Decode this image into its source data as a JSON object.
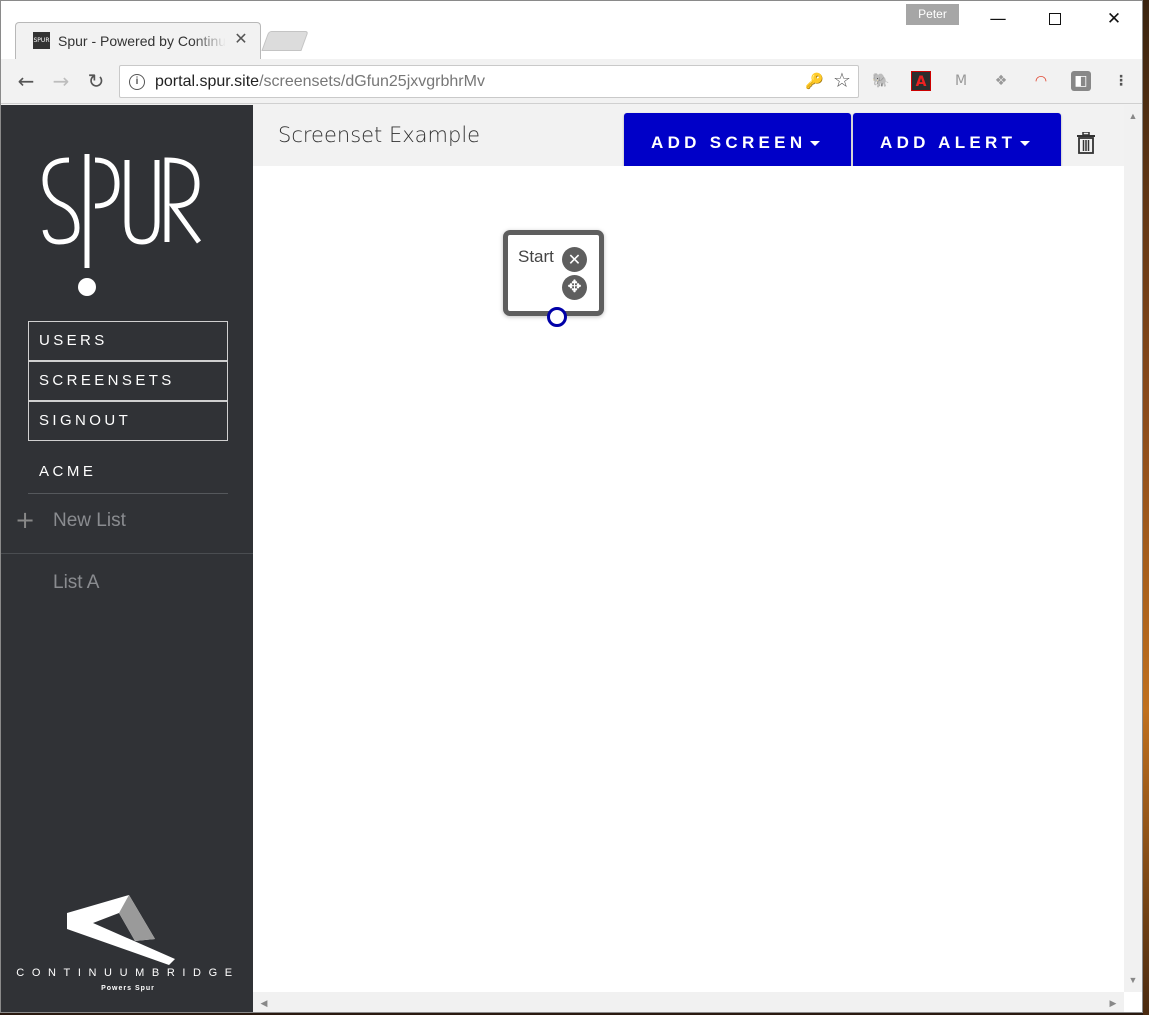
{
  "browser": {
    "tab_favicon_text": "SPUR",
    "tab_title": "Spur - Powered by Continuum",
    "tab_close": "✕",
    "profile_name": "Peter",
    "window_minimize": "—",
    "window_close": "✕",
    "back_icon": "←",
    "forward_icon": "→",
    "reload_icon": "↻",
    "info_icon": "i",
    "url_host": "portal.spur.site",
    "url_path": "/screensets/dGfun25jxvgrbhrMv",
    "key_icon": "🔑",
    "star_icon": "☆",
    "extensions": {
      "evernote": "🐘",
      "pdf": "A",
      "gmail": "M",
      "dropbox": "❖",
      "color": "◠",
      "shield": "◧",
      "menu": "⋮"
    }
  },
  "sidebar": {
    "logo_text": "SPUR",
    "nav": {
      "users": "USERS",
      "screensets": "SCREENSETS",
      "signout": "SIGNOUT"
    },
    "org": "ACME",
    "new_list_icon": "+",
    "new_list_label": "New List",
    "lists": [
      "List A"
    ],
    "footer_brand": "CONTINUUMBRIDGE",
    "footer_sub": "Powers Spur"
  },
  "main": {
    "title": "Screenset Example",
    "add_screen_label": "ADD SCREEN",
    "add_alert_label": "ADD ALERT",
    "node": {
      "label": "Start",
      "close_icon": "✕",
      "move_icon": "✥"
    }
  },
  "scroll": {
    "up": "▲",
    "down": "▼",
    "left": "◀",
    "right": "▶"
  },
  "colors": {
    "accent_button": "#0000c8",
    "sidebar_bg": "#303236",
    "connector": "#0000a8"
  }
}
